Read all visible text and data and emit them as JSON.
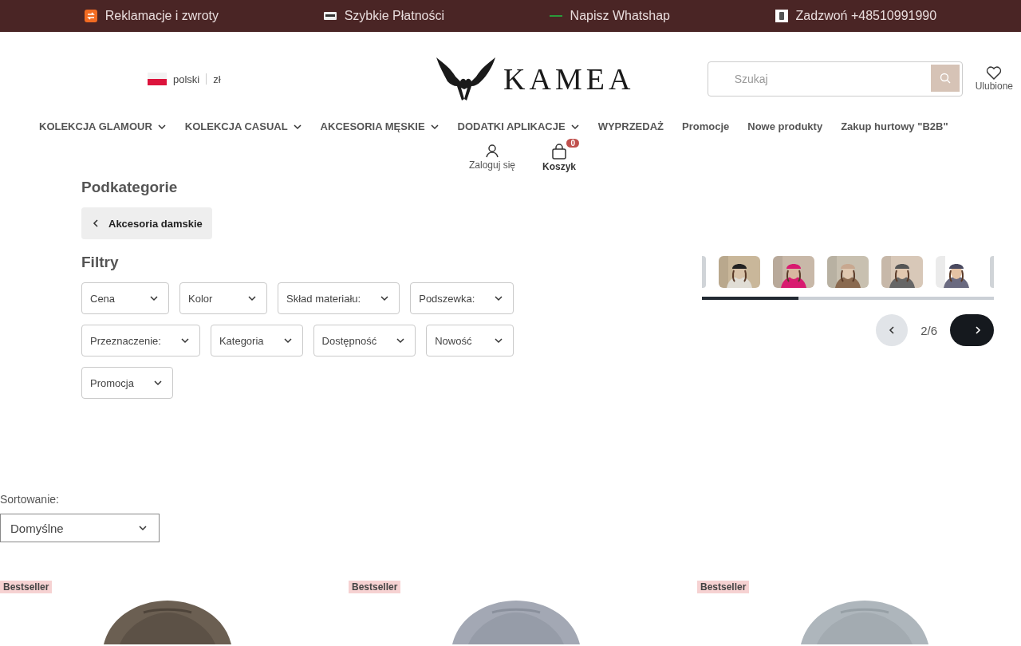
{
  "top_bar": [
    {
      "kind": "returns",
      "text": "Reklamacje i zwroty"
    },
    {
      "kind": "payments",
      "text": "Szybkie Płatności"
    },
    {
      "kind": "whatsapp",
      "text": "Napisz Whatshap"
    },
    {
      "kind": "phone",
      "text": "Zadzwoń +48510991990"
    }
  ],
  "header": {
    "language": "polski",
    "currency": "zł",
    "logo": "KAMEA",
    "search": {
      "placeholder": "Szukaj"
    },
    "wishlist": "Ulubione"
  },
  "nav": [
    {
      "label": "KOLEKCJA GLAMOUR",
      "dropdown": true
    },
    {
      "label": "KOLEKCJA CASUAL",
      "dropdown": true
    },
    {
      "label": "AKCESORIA MĘSKIE",
      "dropdown": true
    },
    {
      "label": "DODATKI APLIKACJE",
      "dropdown": true
    },
    {
      "label": "WYPRZEDAŻ",
      "dropdown": false
    },
    {
      "label": "Promocje",
      "dropdown": false
    },
    {
      "label": "Nowe produkty",
      "dropdown": false
    },
    {
      "label": "Zakup hurtowy \"B2B\"",
      "dropdown": false
    }
  ],
  "account": {
    "login": "Zaloguj się",
    "cart": {
      "label": "Koszyk",
      "count": "0"
    }
  },
  "subcategories": {
    "title": "Podkategorie",
    "back": "Akcesoria damskie"
  },
  "filters": {
    "title": "Filtry",
    "items": [
      "Cena",
      "Kolor",
      "Skład materiału:",
      "Podszewka:",
      "Przeznaczenie:",
      "Kategoria",
      "Dostępność",
      "Nowość",
      "Promocja"
    ]
  },
  "carousel": {
    "progress": {
      "level": 0.33
    },
    "page": "2/6"
  },
  "sort": {
    "label": "Sortowanie:",
    "value": "Domyślne"
  },
  "products": [
    {
      "badge": "Bestseller"
    },
    {
      "badge": "Bestseller"
    },
    {
      "badge": "Bestseller"
    }
  ]
}
